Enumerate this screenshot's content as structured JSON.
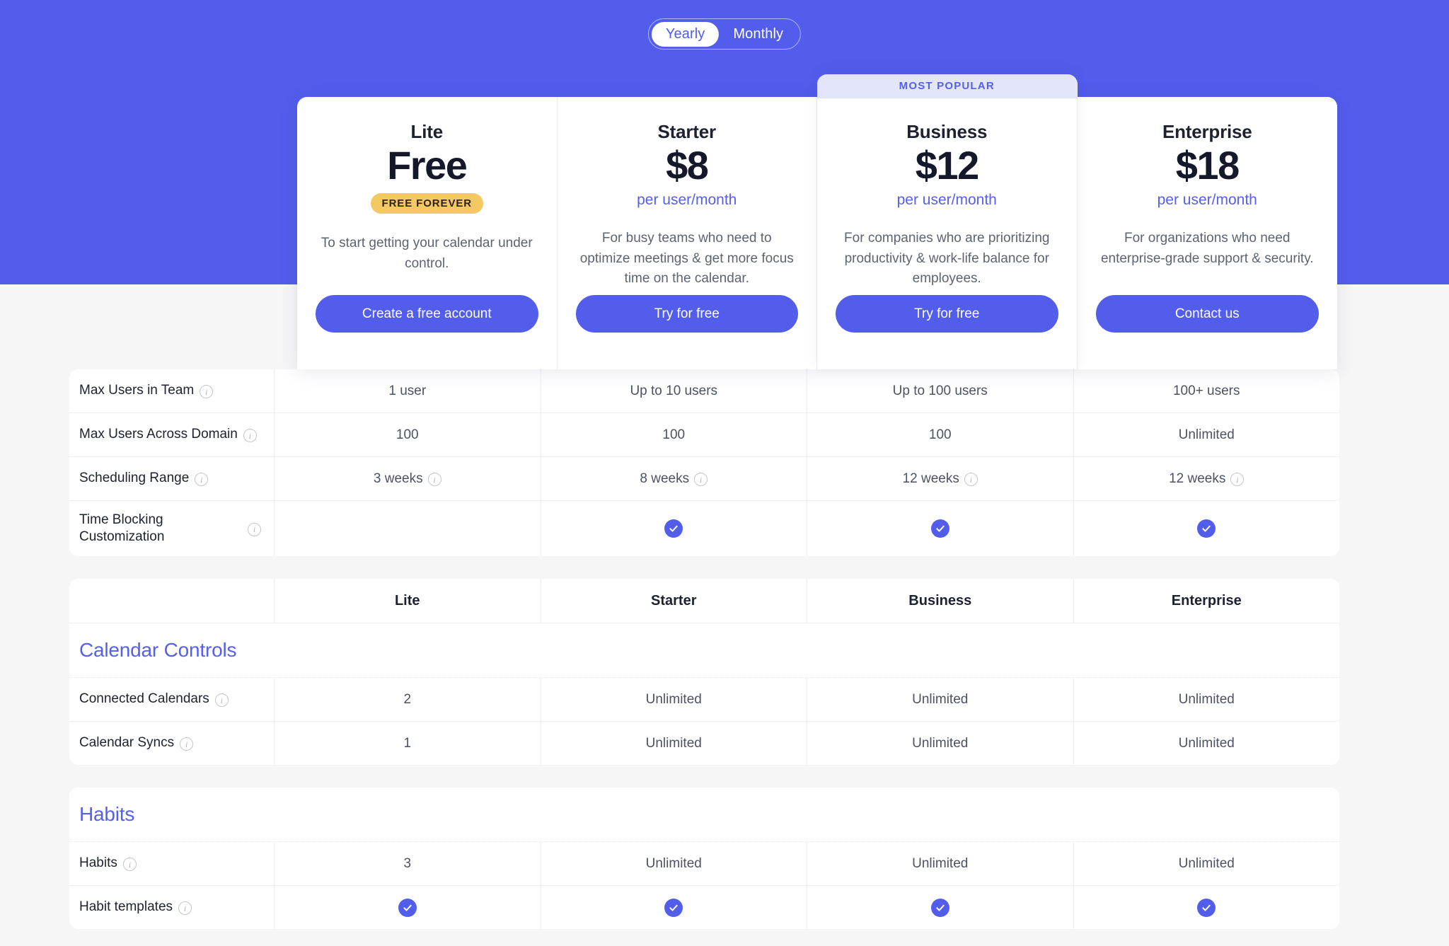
{
  "theme": {
    "hero_purple": "#525DEC",
    "accent": "#5560EC",
    "page_bg": "#F6F6F7",
    "badge_yellow": "#F4C863",
    "popular_bg": "#E3E5FB"
  },
  "billing_toggle": {
    "options": [
      {
        "label": "Yearly",
        "active": true
      },
      {
        "label": "Monthly",
        "active": false
      }
    ]
  },
  "popular_label": "MOST POPULAR",
  "plans": [
    {
      "name": "Lite",
      "price": "Free",
      "period": "",
      "badge": "FREE FOREVER",
      "description": "To start getting your calendar under control.",
      "cta": "Create a free account"
    },
    {
      "name": "Starter",
      "price": "$8",
      "period": "per user/month",
      "badge": "",
      "description": "For busy teams who need to optimize meetings & get more focus time on the calendar.",
      "cta": "Try for free"
    },
    {
      "name": "Business",
      "price": "$12",
      "period": "per user/month",
      "badge": "",
      "description": "For companies who are prioritizing productivity & work-life balance for employees.",
      "cta": "Try for free",
      "most_popular": true
    },
    {
      "name": "Enterprise",
      "price": "$18",
      "period": "per user/month",
      "badge": "",
      "description": "For organizations who need enterprise-grade support & security.",
      "cta": "Contact us"
    }
  ],
  "table_top": {
    "rows": [
      {
        "label": "Max Users in Team",
        "has_info": true,
        "values": [
          {
            "text": "1 user",
            "info": false
          },
          {
            "text": "Up to 10 users",
            "info": false
          },
          {
            "text": "Up to 100 users",
            "info": false
          },
          {
            "text": "100+ users",
            "info": false
          }
        ]
      },
      {
        "label": "Max Users Across Domain",
        "has_info": true,
        "values": [
          {
            "text": "100",
            "info": false
          },
          {
            "text": "100",
            "info": false
          },
          {
            "text": "100",
            "info": false
          },
          {
            "text": "Unlimited",
            "info": false
          }
        ]
      },
      {
        "label": "Scheduling Range",
        "has_info": true,
        "values": [
          {
            "text": "3 weeks",
            "info": true
          },
          {
            "text": "8 weeks",
            "info": true
          },
          {
            "text": "12 weeks",
            "info": true
          },
          {
            "text": "12 weeks",
            "info": true
          }
        ]
      },
      {
        "label": "Time Blocking Customization",
        "has_info": true,
        "tall": true,
        "values": [
          {
            "text": "",
            "check": false
          },
          {
            "text": "",
            "check": true
          },
          {
            "text": "",
            "check": true
          },
          {
            "text": "",
            "check": true
          }
        ]
      }
    ]
  },
  "table_calendar": {
    "column_headers": [
      "",
      "Lite",
      "Starter",
      "Business",
      "Enterprise"
    ],
    "section_title": "Calendar Controls",
    "rows": [
      {
        "label": "Connected Calendars",
        "has_info": true,
        "values": [
          {
            "text": "2"
          },
          {
            "text": "Unlimited"
          },
          {
            "text": "Unlimited"
          },
          {
            "text": "Unlimited"
          }
        ]
      },
      {
        "label": "Calendar Syncs",
        "has_info": true,
        "values": [
          {
            "text": "1"
          },
          {
            "text": "Unlimited"
          },
          {
            "text": "Unlimited"
          },
          {
            "text": "Unlimited"
          }
        ]
      }
    ]
  },
  "table_habits": {
    "section_title": "Habits",
    "rows": [
      {
        "label": "Habits",
        "has_info": true,
        "values": [
          {
            "text": "3"
          },
          {
            "text": "Unlimited"
          },
          {
            "text": "Unlimited"
          },
          {
            "text": "Unlimited"
          }
        ]
      },
      {
        "label": "Habit templates",
        "has_info": true,
        "values": [
          {
            "text": "",
            "check": true
          },
          {
            "text": "",
            "check": true
          },
          {
            "text": "",
            "check": true
          },
          {
            "text": "",
            "check": true
          }
        ]
      }
    ]
  }
}
